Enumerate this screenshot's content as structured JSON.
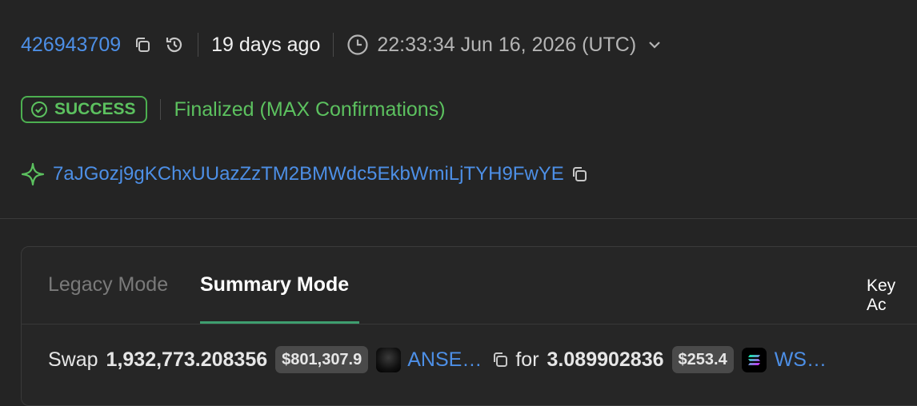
{
  "header": {
    "slot": "426943709",
    "age": "19 days ago",
    "timestamp": "22:33:34 Jun 16, 2026 (UTC)"
  },
  "status": {
    "badge": "SUCCESS",
    "finality": "Finalized (MAX Confirmations)"
  },
  "signer": {
    "address": "7aJGozj9gKChxUUazZzTM2BMWdc5EkbWmiLjTYH9FwYE"
  },
  "tabs": {
    "legacy": "Legacy Mode",
    "summary": "Summary Mode",
    "key": "Key Ac"
  },
  "swap": {
    "verb": "Swap",
    "amount_in": "1,932,773.208356",
    "value_in": "$801,307.9",
    "token_in": "ANSE…",
    "connector": "for",
    "amount_out": "3.089902836",
    "value_out": "$253.4",
    "token_out": "WS…"
  },
  "colors": {
    "link": "#4d8fe6",
    "success": "#5cc15f",
    "tab_active_underline": "#3e9e6f"
  }
}
